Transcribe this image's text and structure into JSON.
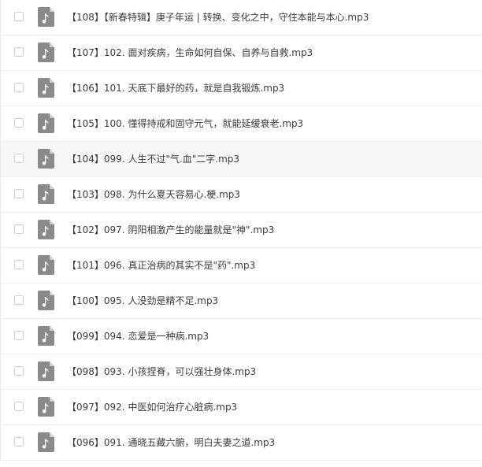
{
  "colors": {
    "icon_bg": "#8a8a8a",
    "icon_fold": "#cfcfcf",
    "text": "#3b3b3b",
    "row_border": "#efefef",
    "hover_bg": "#f7f7f7"
  },
  "files": [
    {
      "name": "【108】【新春特辑】庚子年运 | 转换、变化之中，守住本能与本心.mp3",
      "icon": "music-note-icon",
      "checked": false
    },
    {
      "name": "【107】102. 面对疾病，生命如何自保、自养与自救.mp3",
      "icon": "music-note-icon",
      "checked": false
    },
    {
      "name": "【106】101. 天底下最好的药，就是自我锻炼.mp3",
      "icon": "music-note-icon",
      "checked": false
    },
    {
      "name": "【105】100. 懂得持戒和固守元气，就能延缓衰老.mp3",
      "icon": "music-note-icon",
      "checked": false
    },
    {
      "name": "【104】099. 人生不过\"气.血\"二字.mp3",
      "icon": "music-note-icon",
      "checked": false
    },
    {
      "name": "【103】098. 为什么夏天容易心.梗.mp3",
      "icon": "music-note-icon",
      "checked": false
    },
    {
      "name": "【102】097. 阴阳相激产生的能量就是\"神\".mp3",
      "icon": "music-note-icon",
      "checked": false
    },
    {
      "name": "【101】096. 真正治病的其实不是\"药\".mp3",
      "icon": "music-note-icon",
      "checked": false
    },
    {
      "name": "【100】095. 人没劲是精不足.mp3",
      "icon": "music-note-icon",
      "checked": false
    },
    {
      "name": "【099】094. 恋爱是一种病.mp3",
      "icon": "music-note-icon",
      "checked": false
    },
    {
      "name": "【098】093. 小孩捏脊，可以强壮身体.mp3",
      "icon": "music-note-icon",
      "checked": false
    },
    {
      "name": "【097】092. 中医如何治疗心脏病.mp3",
      "icon": "music-note-icon",
      "checked": false
    },
    {
      "name": "【096】091. 通晓五藏六腑，明白夫妻之道.mp3",
      "icon": "music-note-icon",
      "checked": false
    }
  ]
}
